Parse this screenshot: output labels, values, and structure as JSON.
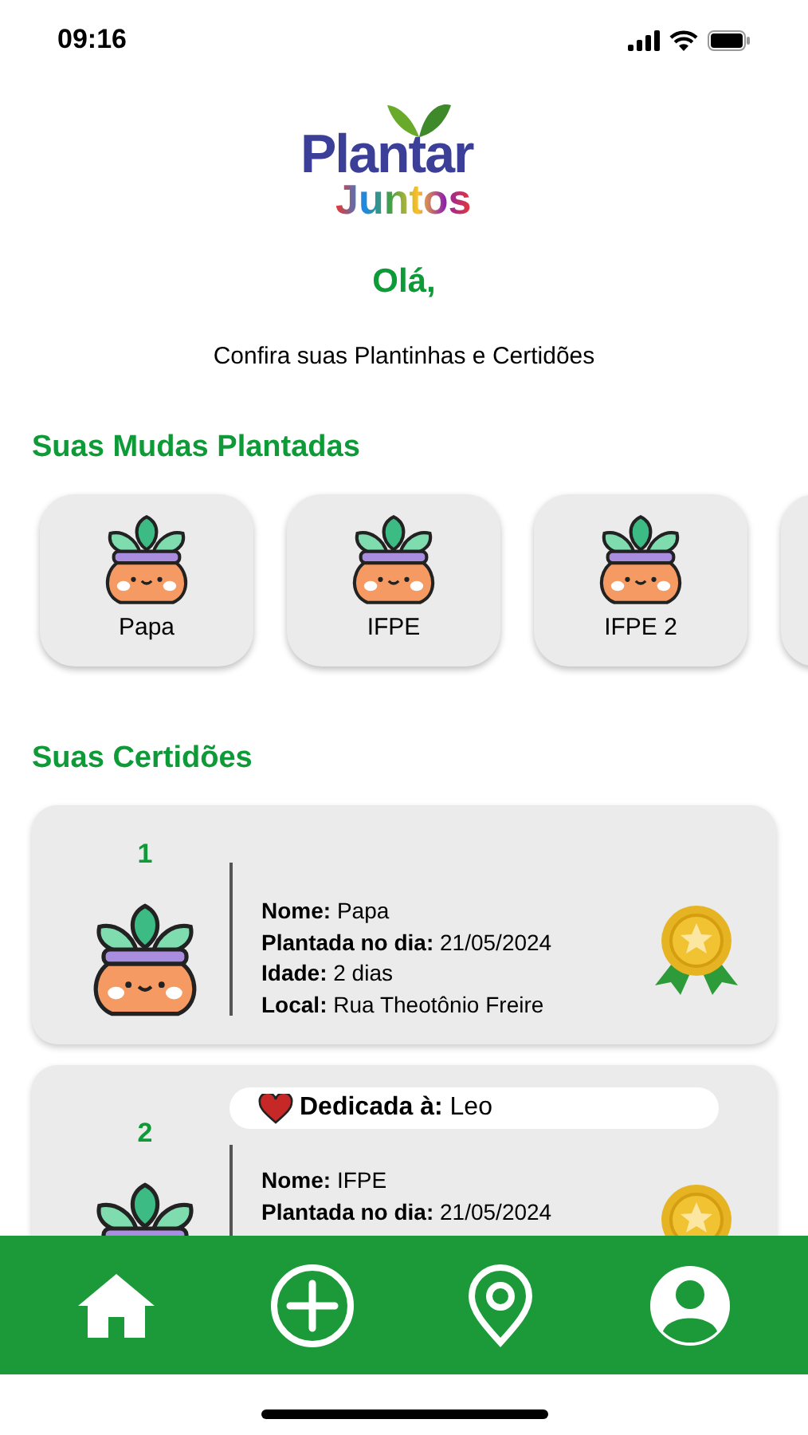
{
  "status_bar": {
    "time": "09:16"
  },
  "logo": {
    "line_1": "Plantar",
    "line_2": "Juntos"
  },
  "greeting": "Olá,",
  "subtitle": "Confira suas Plantinhas e Certidões",
  "plants_section": {
    "title": "Suas Mudas Plantadas",
    "plants": [
      {
        "kind": "plant",
        "name": "Papa"
      },
      {
        "kind": "plant",
        "name": "IFPE"
      },
      {
        "kind": "plant",
        "name": "IFPE 2"
      },
      {
        "kind": "cut_off"
      }
    ]
  },
  "certificates_section": {
    "title": "Suas Certidões",
    "certificates": [
      {
        "number": "1",
        "fields": [
          {
            "label": "Nome:",
            "value": "Papa"
          },
          {
            "label": "Plantada no dia:",
            "value": "21/05/2024"
          },
          {
            "label": "Idade:",
            "value": "2 dias"
          },
          {
            "label": "Local:",
            "value": "Rua Theotônio Freire"
          }
        ]
      },
      {
        "number": "2",
        "dedication": {
          "label": "Dedicada à:",
          "value": "Leo"
        },
        "fields": [
          {
            "label": "Nome:",
            "value": "IFPE"
          },
          {
            "label": "Plantada no dia:",
            "value": "21/05/2024"
          }
        ]
      }
    ]
  },
  "bottom_nav": [
    {
      "kind": "home"
    },
    {
      "kind": "add"
    },
    {
      "kind": "location"
    },
    {
      "kind": "profile"
    }
  ]
}
